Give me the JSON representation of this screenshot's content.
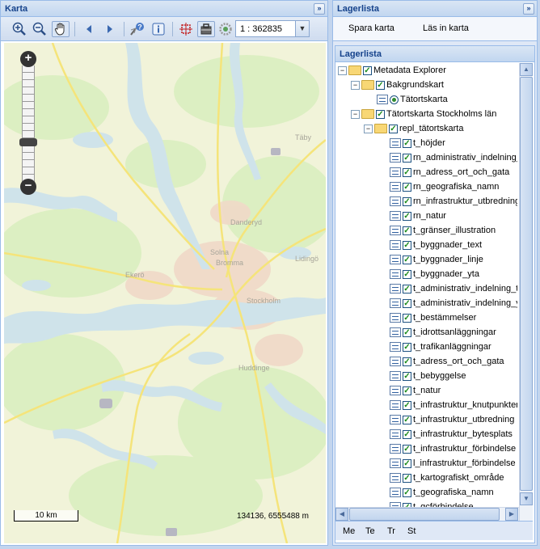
{
  "map_panel": {
    "title": "Karta",
    "collapse_icon": "double-chevron-right-icon",
    "toolbar": {
      "buttons": [
        "zoom-in-icon",
        "zoom-out-icon",
        "pan-hand-icon",
        "back-arrow-icon",
        "forward-arrow-icon",
        "identify-icon",
        "info-icon",
        "select-box-icon",
        "toolbox-icon",
        "measure-icon"
      ],
      "scale_value": "1 : 362835"
    },
    "scale_legend": "10 km",
    "coordinates": "134136, 6555488 m"
  },
  "layer_panel": {
    "title": "Lagerlista",
    "collapse_icon": "double-chevron-right-icon",
    "save_map": "Spara karta",
    "load_map": "Läs in karta",
    "subtitle": "Lagerlista",
    "tree": {
      "root": "Metadata Explorer",
      "basemap_group": "Bakgrundskart",
      "basemap_layer": "Tätortskarta",
      "county_group": "Tätortskarta Stockholms län",
      "repl_group": "repl_tätortskarta",
      "layers": [
        "t_höjder",
        "rn_administrativ_indelning_t",
        "rn_adress_ort_och_gata",
        "rn_geografiska_namn",
        "rn_infrastruktur_utbredning",
        "rn_natur",
        "t_gränser_illustration",
        "t_byggnader_text",
        "t_byggnader_linje",
        "t_byggnader_yta",
        "t_administrativ_indelning_te",
        "t_administrativ_indelning_yt",
        "t_bestämmelser",
        "t_idrottsanläggningar",
        "t_trafikanläggningar",
        "t_adress_ort_och_gata",
        "t_bebyggelse",
        "t_natur",
        "t_infrastruktur_knutpunkter",
        "t_infrastruktur_utbredning",
        "t_infrastruktur_bytesplats",
        "t_infrastruktur_förbindelse",
        "l_infrastruktur_förbindelse",
        "t_kartografiskt_område",
        "t_geografiska_namn",
        "t_gcförbindelse"
      ]
    },
    "tabs": [
      "Me",
      "Te",
      "Tr",
      "St"
    ]
  }
}
